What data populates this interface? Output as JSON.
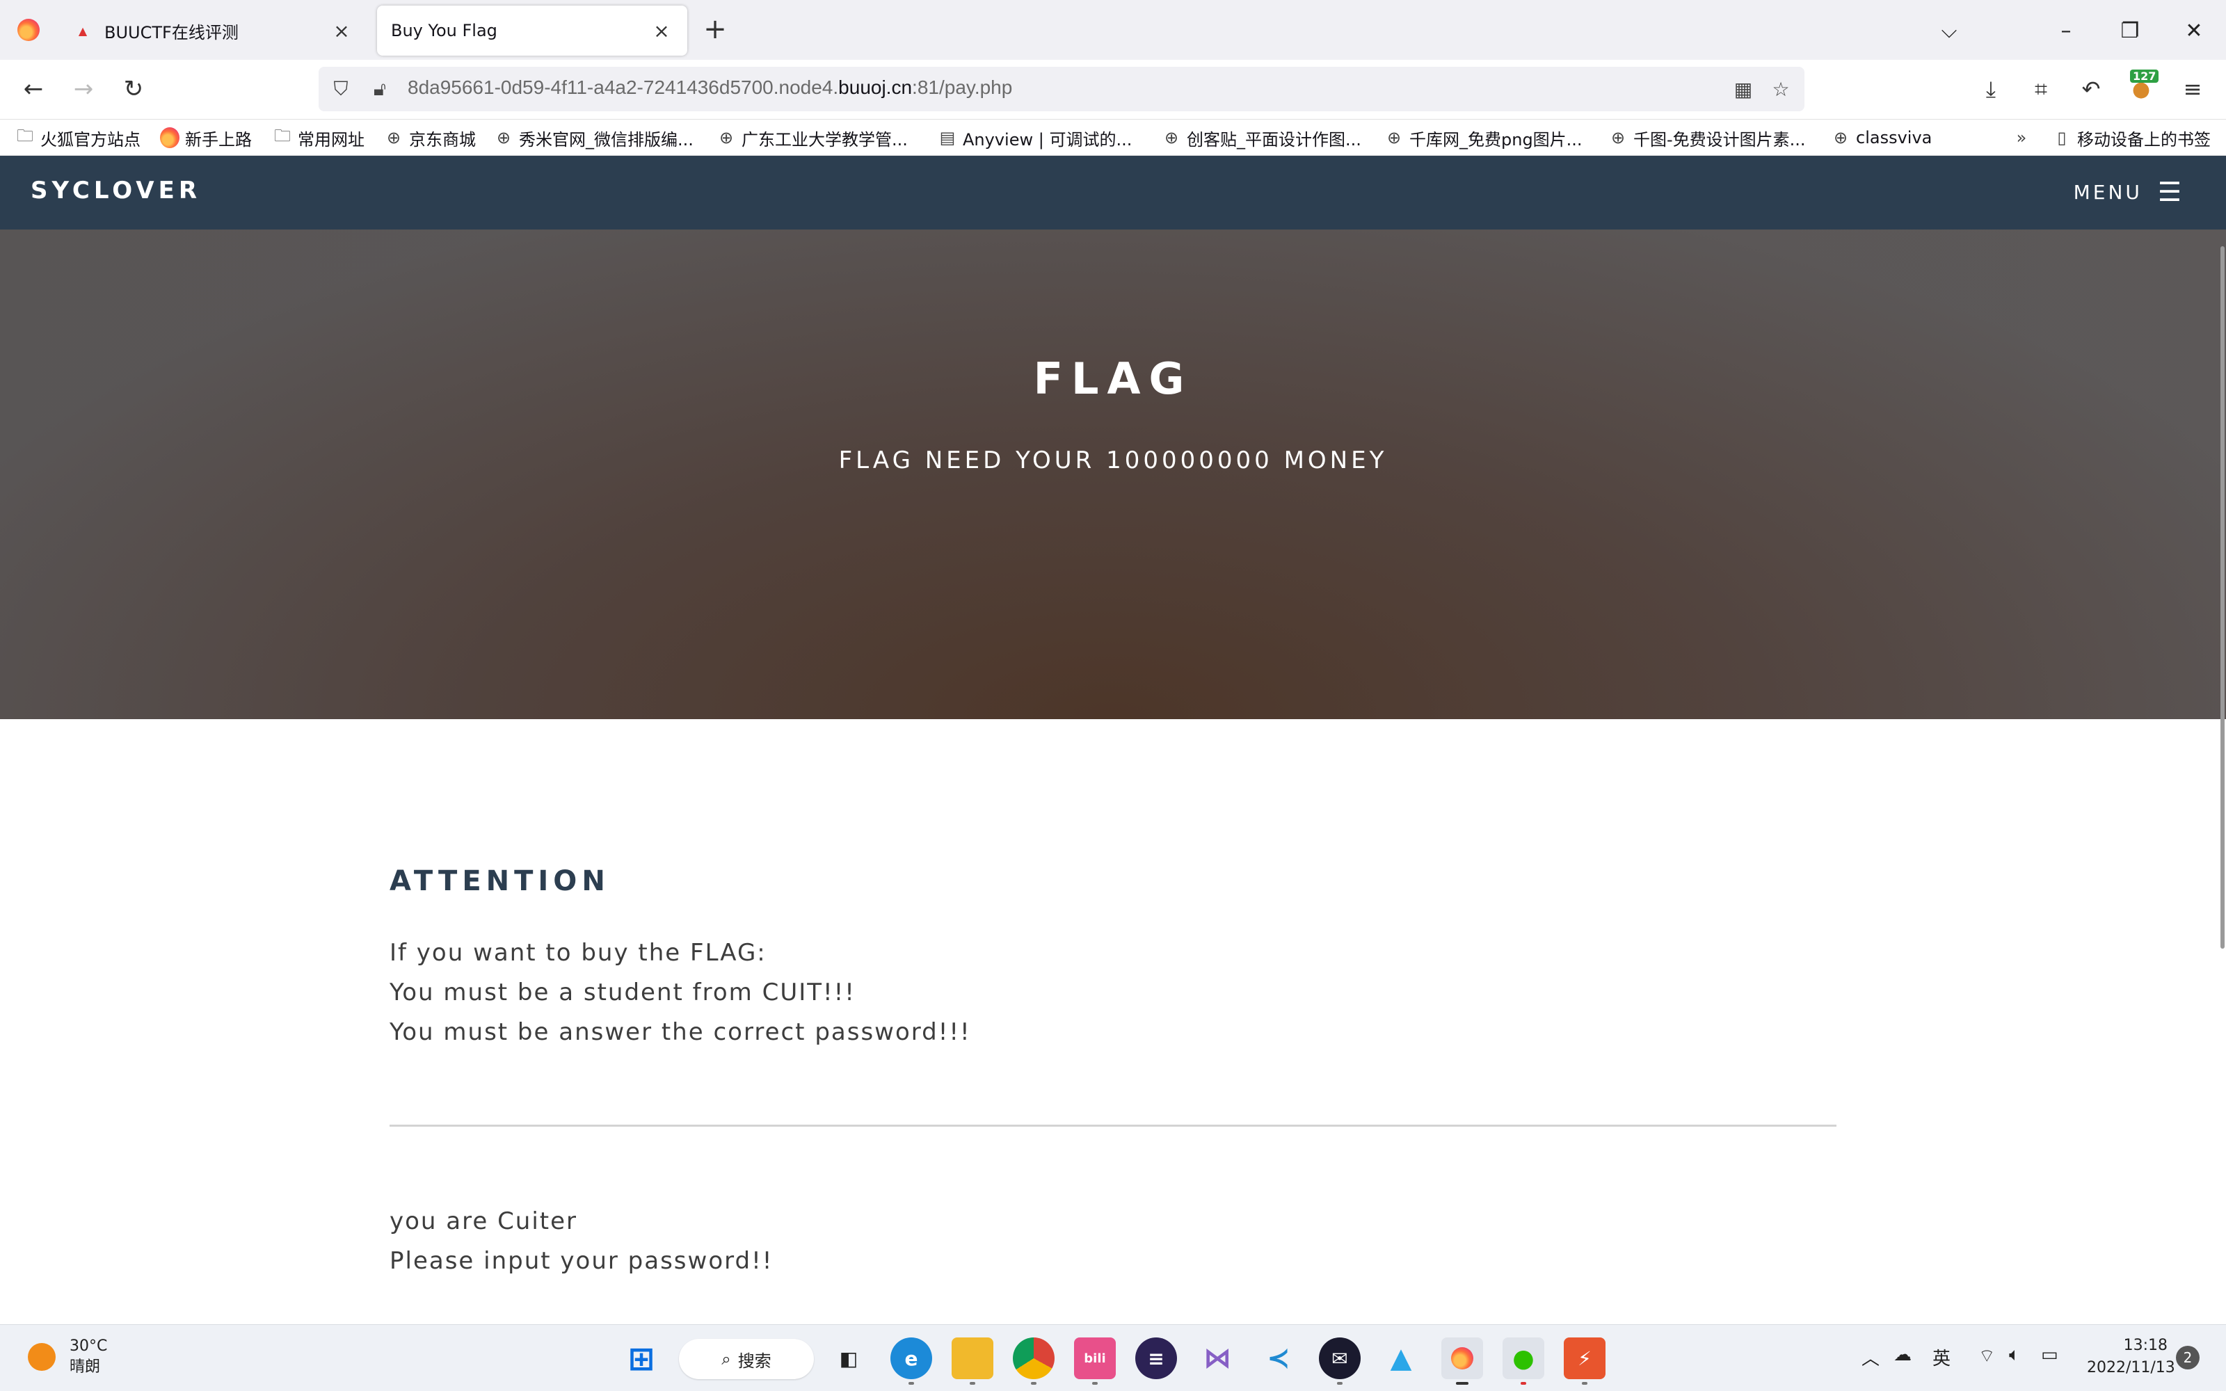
{
  "browser": {
    "tabs": [
      {
        "title": "BUUCTF在线评测",
        "favicon": "buuctf-favicon",
        "active": false
      },
      {
        "title": "Buy You Flag",
        "favicon": "none",
        "active": true
      }
    ],
    "url": {
      "prefix": "8da95661-0d59-4f11-a4a2-7241436d5700.node4.",
      "host": "buuoj.cn",
      "suffix": ":81/pay.php"
    },
    "extension_badge": "127",
    "bookmarks": [
      {
        "label": "火狐官方站点",
        "icon": "folder-icon"
      },
      {
        "label": "新手上路",
        "icon": "firefox-icon"
      },
      {
        "label": "常用网址",
        "icon": "folder-icon"
      },
      {
        "label": "京东商城",
        "icon": "globe-icon"
      },
      {
        "label": "秀米官网_微信排版编...",
        "icon": "globe-icon"
      },
      {
        "label": "广东工业大学教学管...",
        "icon": "globe-icon"
      },
      {
        "label": "Anyview | 可调试的...",
        "icon": "anyview-icon"
      },
      {
        "label": "创客贴_平面设计作图...",
        "icon": "globe-icon"
      },
      {
        "label": "千库网_免费png图片...",
        "icon": "globe-icon"
      },
      {
        "label": "千图-免费设计图片素...",
        "icon": "globe-icon"
      },
      {
        "label": "classviva",
        "icon": "globe-icon"
      }
    ],
    "mobile_bookmarks": "移动设备上的书签"
  },
  "site": {
    "brand": "SYCLOVER",
    "menu_label": "MENU",
    "hero": {
      "title": "FLAG",
      "subtitle": "FLAG NEED YOUR 100000000 MONEY"
    },
    "attention": {
      "title": "ATTENTION",
      "lines": [
        "If you want to buy the FLAG:",
        "You must be a student from CUIT!!!",
        "You must be answer the correct password!!!"
      ]
    },
    "messages": [
      "you are Cuiter",
      "Please input your password!!"
    ]
  },
  "taskbar": {
    "weather": {
      "temp": "30°C",
      "condition": "晴朗"
    },
    "search_label": "搜索",
    "tray": {
      "ime": "英"
    },
    "clock": {
      "time": "13:18",
      "date": "2022/11/13"
    },
    "notifications": "2"
  },
  "colors": {
    "site_nav_bg": "#2c3e50",
    "hero_gradient_warm": "#4c3426",
    "accent_heading": "#2c3e50"
  }
}
